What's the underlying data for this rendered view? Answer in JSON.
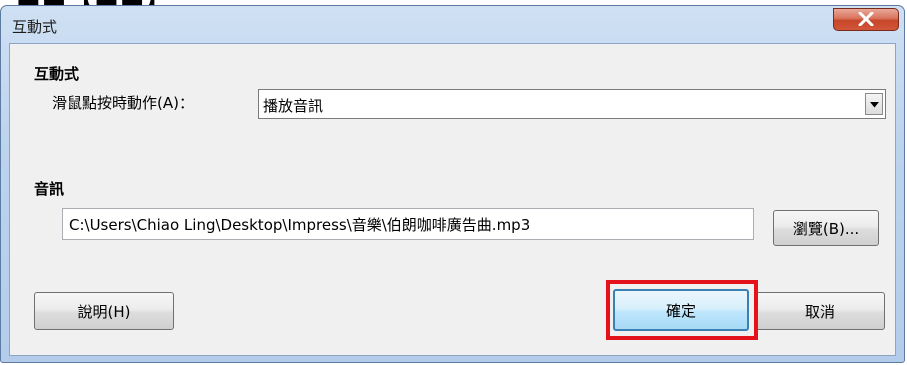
{
  "window": {
    "title": "互動式"
  },
  "interactive_section": {
    "heading": "互動式",
    "action_label": "滑鼠點按時動作(A)：",
    "action_value": "播放音訊"
  },
  "audio_section": {
    "heading": "音訊",
    "file_path": "C:\\Users\\Chiao Ling\\Desktop\\Impress\\音樂\\伯朗咖啡廣告曲.mp3",
    "browse_label": "瀏覽(B)..."
  },
  "buttons": {
    "help_label": "說明(H)",
    "ok_label": "確定",
    "cancel_label": "取消"
  },
  "highlight": {
    "color": "#e3121b",
    "target": "ok-button"
  },
  "colors": {
    "titlebar": "#bcd3ee",
    "close_button": "#c64628",
    "default_button_border": "#3c7fb1"
  },
  "icons": {
    "close": "close-icon",
    "dropdown": "chevron-down-icon"
  }
}
